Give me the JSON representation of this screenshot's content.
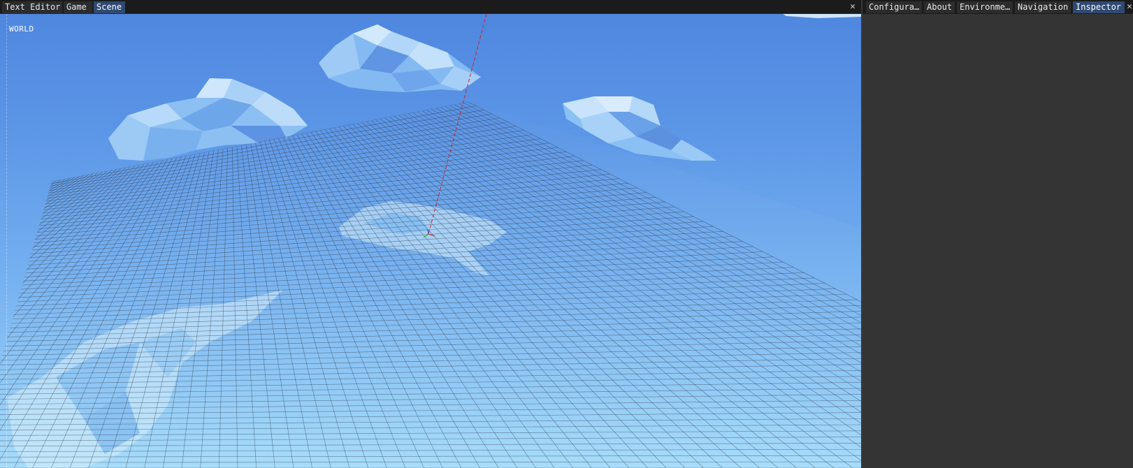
{
  "left_dock": {
    "tabs": [
      {
        "label": "Text Editor",
        "active": false
      },
      {
        "label": "Game",
        "active": false
      },
      {
        "label": "Scene",
        "active": true
      }
    ],
    "close_glyph": "✕"
  },
  "viewport": {
    "corner_label": "WORLD"
  },
  "right_dock": {
    "tabs": [
      {
        "label": "Configura…",
        "active": false
      },
      {
        "label": "About",
        "active": false
      },
      {
        "label": "Environme…",
        "active": false
      },
      {
        "label": "Navigation",
        "active": false
      },
      {
        "label": "Inspector",
        "active": true
      }
    ],
    "close_glyph": "✕"
  },
  "colors": {
    "active_tab": "#2f4a72",
    "inactive_tab": "#2c2c2c",
    "sky_top": "#4f87df",
    "sky_bottom": "#a6dcfb",
    "grid_line": "#2a3140",
    "axis_red": "#d0202a",
    "panel_bg": "#343434"
  }
}
